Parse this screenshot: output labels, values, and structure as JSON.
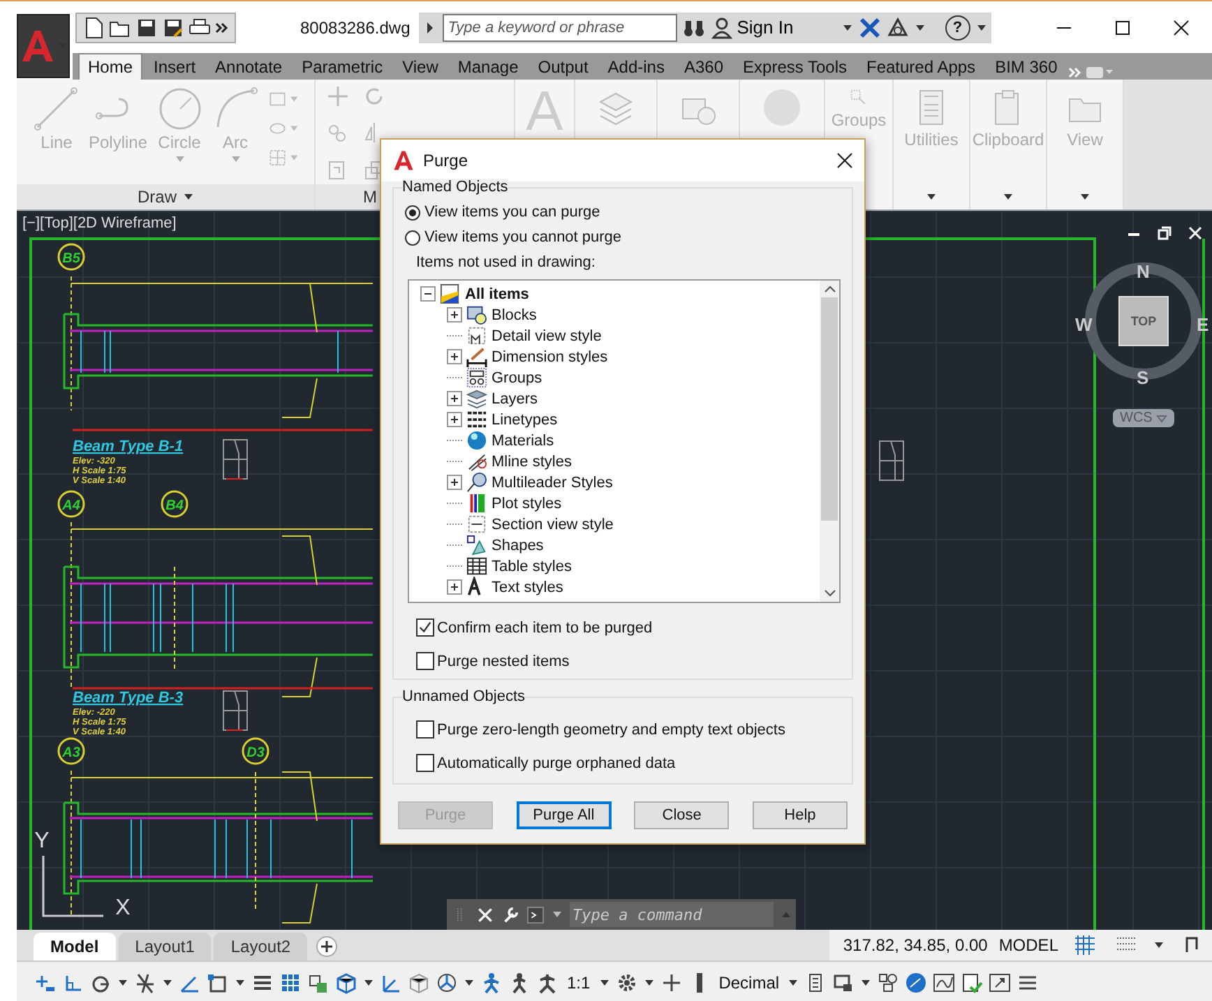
{
  "title_bar": {
    "file_name": "80083286.dwg",
    "search": {
      "placeholder": "Type a keyword or phrase"
    },
    "sign_in": "Sign In",
    "help": "?"
  },
  "ribbon_tabs": [
    {
      "label": "Home",
      "selected": true
    },
    {
      "label": "Insert",
      "selected": false
    },
    {
      "label": "Annotate",
      "selected": false
    },
    {
      "label": "Parametric",
      "selected": false
    },
    {
      "label": "View",
      "selected": false
    },
    {
      "label": "Manage",
      "selected": false
    },
    {
      "label": "Output",
      "selected": false
    },
    {
      "label": "Add-ins",
      "selected": false
    },
    {
      "label": "A360",
      "selected": false
    },
    {
      "label": "Express Tools",
      "selected": false
    },
    {
      "label": "Featured Apps",
      "selected": false
    },
    {
      "label": "BIM 360",
      "selected": false
    }
  ],
  "ribbon": {
    "draw_tools": [
      {
        "label": "Line",
        "has_menu": false
      },
      {
        "label": "Polyline",
        "has_menu": false
      },
      {
        "label": "Circle",
        "has_menu": true
      },
      {
        "label": "Arc",
        "has_menu": true
      }
    ],
    "draw_panel_title": "Draw",
    "modify_panel_title": "M",
    "text_tool_glyph": "A",
    "groups_label": "Groups",
    "large_tools": [
      {
        "label": "Utilities"
      },
      {
        "label": "Clipboard"
      },
      {
        "label": "View"
      }
    ]
  },
  "viewport": {
    "label": "[−][Top][2D Wireframe]",
    "viewcube": {
      "north": "N",
      "south": "S",
      "east": "E",
      "west": "W",
      "face": "TOP",
      "ucs": "WCS"
    },
    "ucs_axes": {
      "x": "X",
      "y": "Y"
    }
  },
  "drawing": {
    "grid_bubbles": [
      "B5",
      "A4",
      "B4",
      "A3",
      "D3"
    ],
    "beam_titles": [
      {
        "title": "Beam Type B-1",
        "notes": [
          "Elev: -320",
          "H Scale 1:75",
          "V Scale 1:40"
        ]
      },
      {
        "title": "Beam Type B-3",
        "notes": [
          "Elev: -220",
          "H Scale 1:75",
          "V Scale 1:40"
        ]
      }
    ]
  },
  "command_line": {
    "placeholder": "Type a command"
  },
  "layout_tabs": [
    {
      "label": "Model",
      "selected": true
    },
    {
      "label": "Layout1",
      "selected": false
    },
    {
      "label": "Layout2",
      "selected": false
    }
  ],
  "status_bar": {
    "coordinates": "317.82, 34.85, 0.00",
    "space": "MODEL",
    "annotation_scale": "1:1",
    "units": "Decimal"
  },
  "purge_dialog": {
    "title": "Purge",
    "named_objects": {
      "legend": "Named Objects",
      "options": [
        {
          "label": "View items you can purge",
          "selected": true
        },
        {
          "label": "View items you cannot purge",
          "selected": false
        }
      ],
      "list_label": "Items not used in drawing:",
      "tree": {
        "label": "All items",
        "expanded": true,
        "children": [
          {
            "label": "Blocks",
            "expandable": true
          },
          {
            "label": "Detail view style",
            "expandable": false
          },
          {
            "label": "Dimension styles",
            "expandable": true
          },
          {
            "label": "Groups",
            "expandable": false
          },
          {
            "label": "Layers",
            "expandable": true
          },
          {
            "label": "Linetypes",
            "expandable": true
          },
          {
            "label": "Materials",
            "expandable": false
          },
          {
            "label": "Mline styles",
            "expandable": false
          },
          {
            "label": "Multileader Styles",
            "expandable": true
          },
          {
            "label": "Plot styles",
            "expandable": false
          },
          {
            "label": "Section view style",
            "expandable": false
          },
          {
            "label": "Shapes",
            "expandable": false
          },
          {
            "label": "Table styles",
            "expandable": false
          },
          {
            "label": "Text styles",
            "expandable": true
          }
        ]
      },
      "checkboxes": [
        {
          "label": "Confirm each item to be purged",
          "checked": true
        },
        {
          "label": "Purge nested items",
          "checked": false
        }
      ]
    },
    "unnamed_objects": {
      "legend": "Unnamed Objects",
      "checkboxes": [
        {
          "label": "Purge zero-length geometry and empty text objects",
          "checked": false
        },
        {
          "label": "Automatically purge orphaned data",
          "checked": false
        }
      ]
    },
    "buttons": [
      {
        "label": "Purge",
        "disabled": true,
        "default": false
      },
      {
        "label": "Purge All",
        "disabled": false,
        "default": true
      },
      {
        "label": "Close",
        "disabled": false,
        "default": false
      },
      {
        "label": "Help",
        "disabled": false,
        "default": false
      }
    ]
  }
}
